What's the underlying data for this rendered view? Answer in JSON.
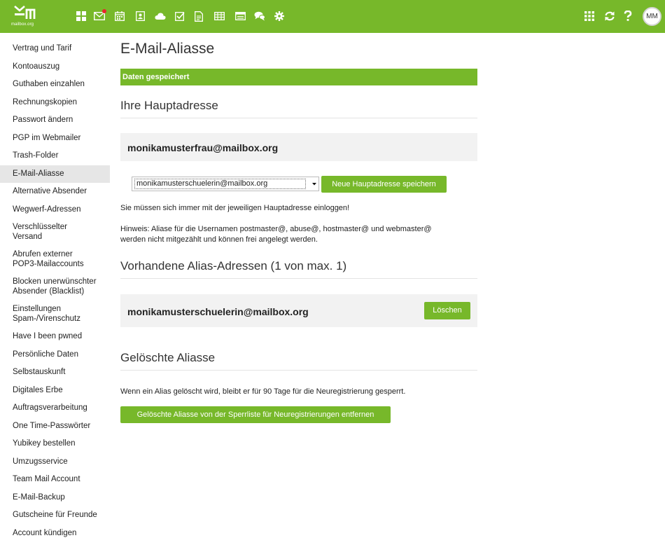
{
  "topbar": {
    "logo_text": "mailbox.org",
    "avatar_initials": "MM",
    "accent_color": "#77b82a",
    "nav_icons": [
      "apps-grid-icon",
      "mail-icon",
      "calendar-icon",
      "contacts-icon",
      "cloud-icon",
      "tasks-icon",
      "document-icon",
      "spreadsheet-icon",
      "presentation-icon",
      "chat-icon",
      "settings-icon"
    ],
    "right_icons": [
      "app-launcher-icon",
      "refresh-icon",
      "help-icon"
    ]
  },
  "sidebar": {
    "items": [
      {
        "label": "Vertrag und Tarif"
      },
      {
        "label": "Kontoauszug"
      },
      {
        "label": "Guthaben einzahlen"
      },
      {
        "label": "Rechnungskopien"
      },
      {
        "label": "Passwort ändern"
      },
      {
        "label": "PGP im Webmailer"
      },
      {
        "label": "Trash-Folder"
      },
      {
        "label": "E-Mail-Aliasse"
      },
      {
        "label": "Alternative Absender"
      },
      {
        "label": "Wegwerf-Adressen"
      },
      {
        "label": "Verschlüsselter Versand"
      },
      {
        "label": "Abrufen externer POP3-Mailaccounts"
      },
      {
        "label": "Blocken unerwünschter Absender (Blacklist)"
      },
      {
        "label": "Einstellungen Spam-/Virenschutz"
      },
      {
        "label": "Have I been pwned"
      },
      {
        "label": "Persönliche Daten"
      },
      {
        "label": "Selbstauskunft"
      },
      {
        "label": "Digitales Erbe"
      },
      {
        "label": "Auftragsverarbeitung"
      },
      {
        "label": "One Time-Passwörter"
      },
      {
        "label": "Yubikey bestellen"
      },
      {
        "label": "Umzugsservice"
      },
      {
        "label": "Team Mail Account"
      },
      {
        "label": "E-Mail-Backup"
      },
      {
        "label": "Gutscheine für Freunde"
      },
      {
        "label": "Account kündigen"
      }
    ]
  },
  "main": {
    "title": "E-Mail-Aliasse",
    "success_message": "Daten gespeichert",
    "primary": {
      "heading": "Ihre Hauptadresse",
      "address": "monikamusterfrau@mailbox.org",
      "select_value": "monikamusterschuelerin@mailbox.org",
      "save_button": "Neue Hauptadresse speichern",
      "login_note": "Sie müssen sich immer mit der jeweiligen Hauptadresse einloggen!",
      "hint_line1": "Hinweis: Aliase für die Usernamen postmaster@, abuse@, hostmaster@ und webmaster@",
      "hint_line2": "werden nicht mitgezählt und können frei angelegt werden."
    },
    "aliases": {
      "heading": "Vorhandene Alias-Adressen (1 von max. 1)",
      "items": [
        {
          "address": "monikamusterschuelerin@mailbox.org",
          "delete_label": "Löschen"
        }
      ]
    },
    "deleted": {
      "heading": "Gelöschte Aliasse",
      "note": "Wenn ein Alias gelöscht wird, bleibt er für 90 Tage für die Neuregistrierung gesperrt.",
      "remove_button": "Gelöschte Aliasse von der Sperrliste für Neuregistrierungen entfernen"
    }
  }
}
